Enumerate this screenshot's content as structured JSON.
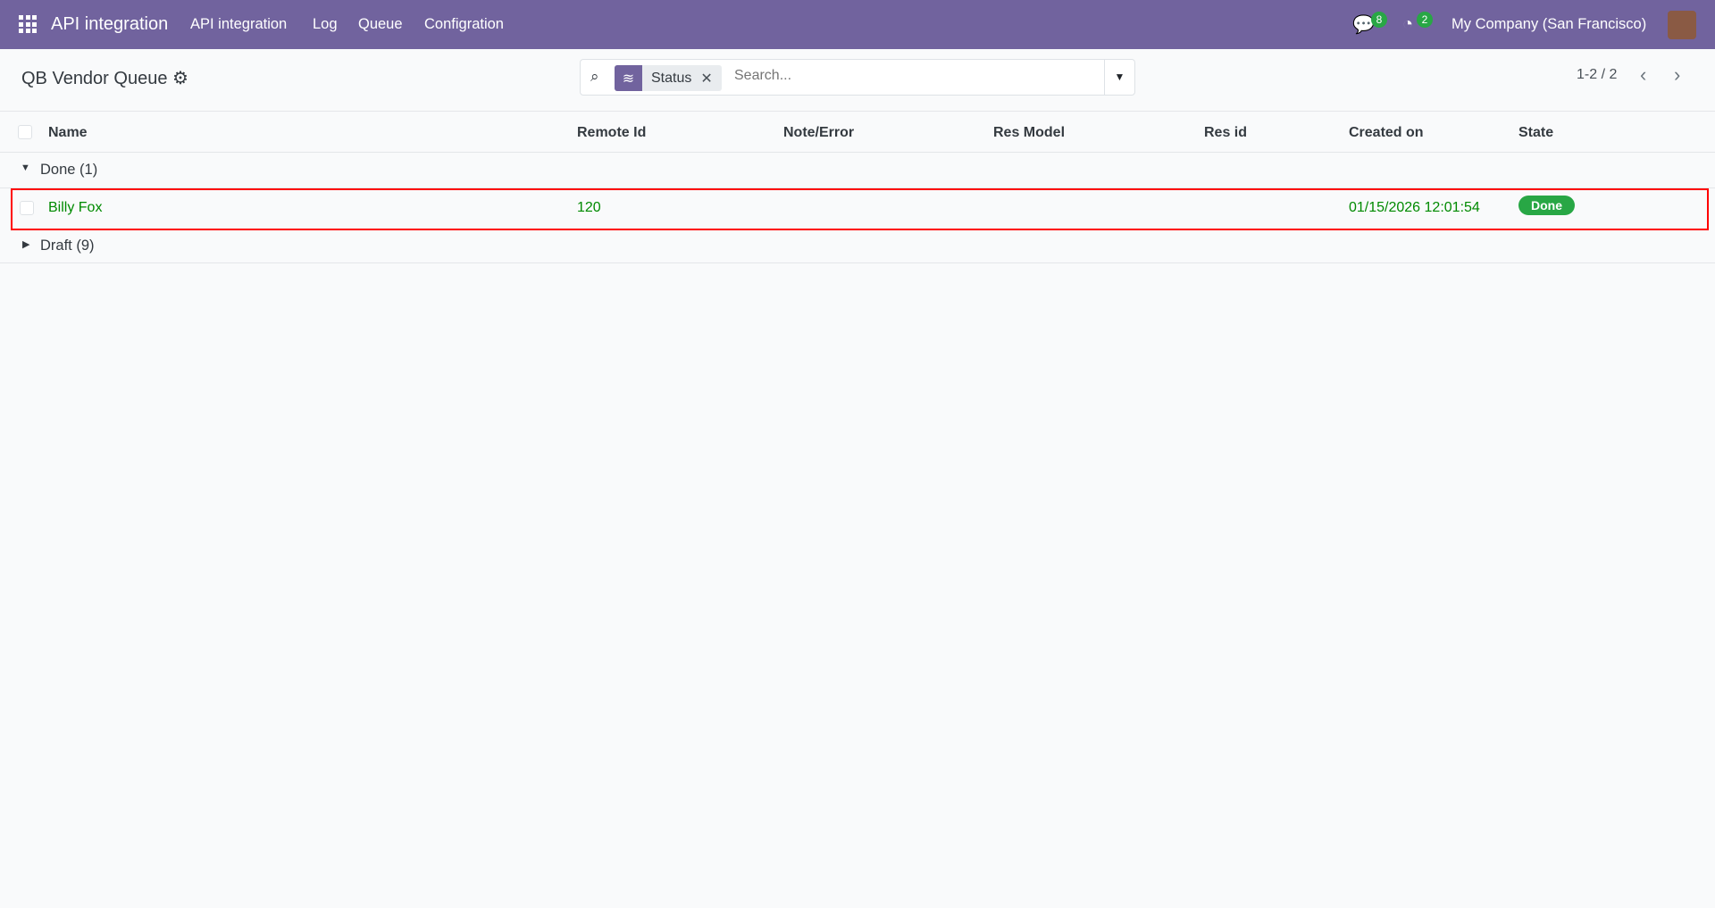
{
  "navbar": {
    "app_name": "API integration",
    "menu": [
      "API integration",
      "Log",
      "Queue",
      "Configration"
    ],
    "messages_count": "8",
    "activities_count": "2",
    "company": "My Company (San Francisco)"
  },
  "control_panel": {
    "title": "QB Vendor Queue",
    "facet_label": "Status",
    "search_placeholder": "Search...",
    "pager": "1-2 / 2"
  },
  "table": {
    "columns": [
      "Name",
      "Remote Id",
      "Note/Error",
      "Res Model",
      "Res id",
      "Created on",
      "State"
    ],
    "groups": [
      {
        "label": "Done (1)",
        "expanded": true,
        "rows": [
          {
            "name": "Billy Fox",
            "remote_id": "120",
            "note": "",
            "res_model": "",
            "res_id": "",
            "created_on": "01/15/2026 12:01:54",
            "state": "Done"
          }
        ]
      },
      {
        "label": "Draft (9)",
        "expanded": false
      }
    ]
  },
  "colors": {
    "navbar": "#71639e",
    "success": "#28a745",
    "highlight": "#ff0000"
  }
}
